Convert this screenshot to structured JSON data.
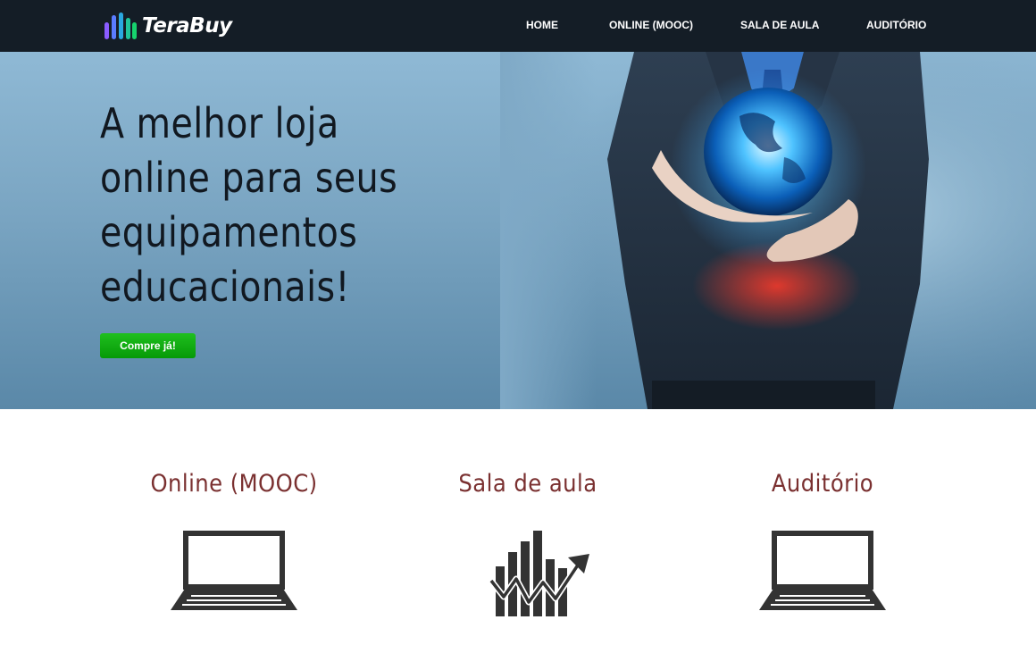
{
  "brand": {
    "name": "TeraBuy",
    "icon": "bar-chart-logo-icon",
    "colors": [
      "#7b5cff",
      "#4f7dff",
      "#22c4a8",
      "#16d36e"
    ]
  },
  "nav": {
    "items": [
      {
        "label": "HOME"
      },
      {
        "label": "ONLINE (MOOC)"
      },
      {
        "label": "SALA DE AULA"
      },
      {
        "label": "AUDITÓRIO"
      }
    ],
    "background": "#141d26"
  },
  "hero": {
    "title_lines": [
      "A melhor loja",
      "online para seus",
      "equipamentos",
      "educacionais!"
    ],
    "button_label": "Compre já!",
    "button_color": "#0aa50a",
    "image": "businessman-holding-glowing-globe"
  },
  "features": [
    {
      "title": "Online (MOOC)",
      "icon": "laptop-icon"
    },
    {
      "title": "Sala de aula",
      "icon": "growth-chart-icon"
    },
    {
      "title": "Auditório",
      "icon": "laptop-icon"
    }
  ],
  "accent_color": "#7a3030"
}
